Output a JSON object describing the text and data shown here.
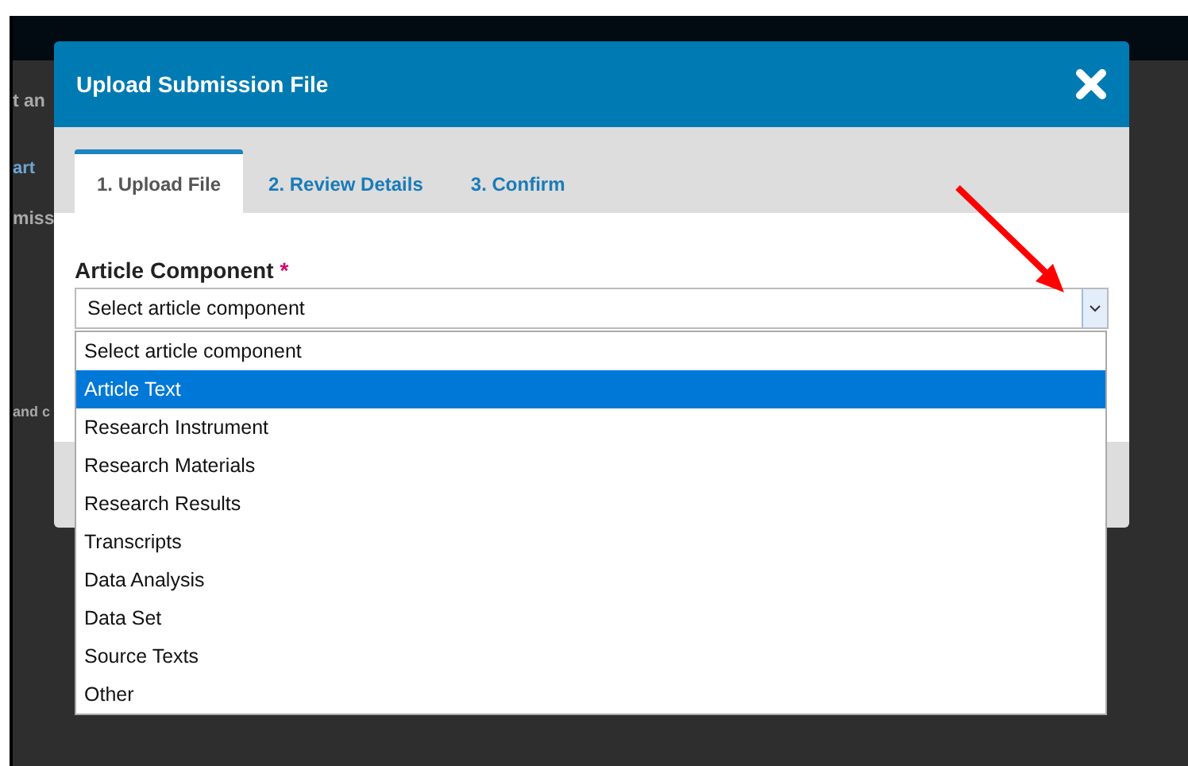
{
  "background": {
    "fragments": [
      {
        "text": "t an",
        "kind": "heading"
      },
      {
        "text": "art",
        "kind": "link"
      },
      {
        "text": "miss",
        "kind": "heading"
      },
      {
        "text": "and c",
        "kind": "small"
      }
    ]
  },
  "modal": {
    "title": "Upload Submission File",
    "tabs": [
      {
        "label": "1. Upload File",
        "selected": true
      },
      {
        "label": "2. Review Details",
        "selected": false
      },
      {
        "label": "3. Confirm",
        "selected": false
      }
    ],
    "field": {
      "label": "Article Component",
      "required_mark": "*",
      "value": "Select article component",
      "expanded": true
    },
    "options": [
      {
        "label": "Select article component",
        "selected": false
      },
      {
        "label": "Article Text",
        "selected": true
      },
      {
        "label": "Research Instrument",
        "selected": false
      },
      {
        "label": "Research Materials",
        "selected": false
      },
      {
        "label": "Research Results",
        "selected": false
      },
      {
        "label": "Transcripts",
        "selected": false
      },
      {
        "label": "Data Analysis",
        "selected": false
      },
      {
        "label": "Data Set",
        "selected": false
      },
      {
        "label": "Source Texts",
        "selected": false
      },
      {
        "label": "Other",
        "selected": false
      }
    ]
  }
}
